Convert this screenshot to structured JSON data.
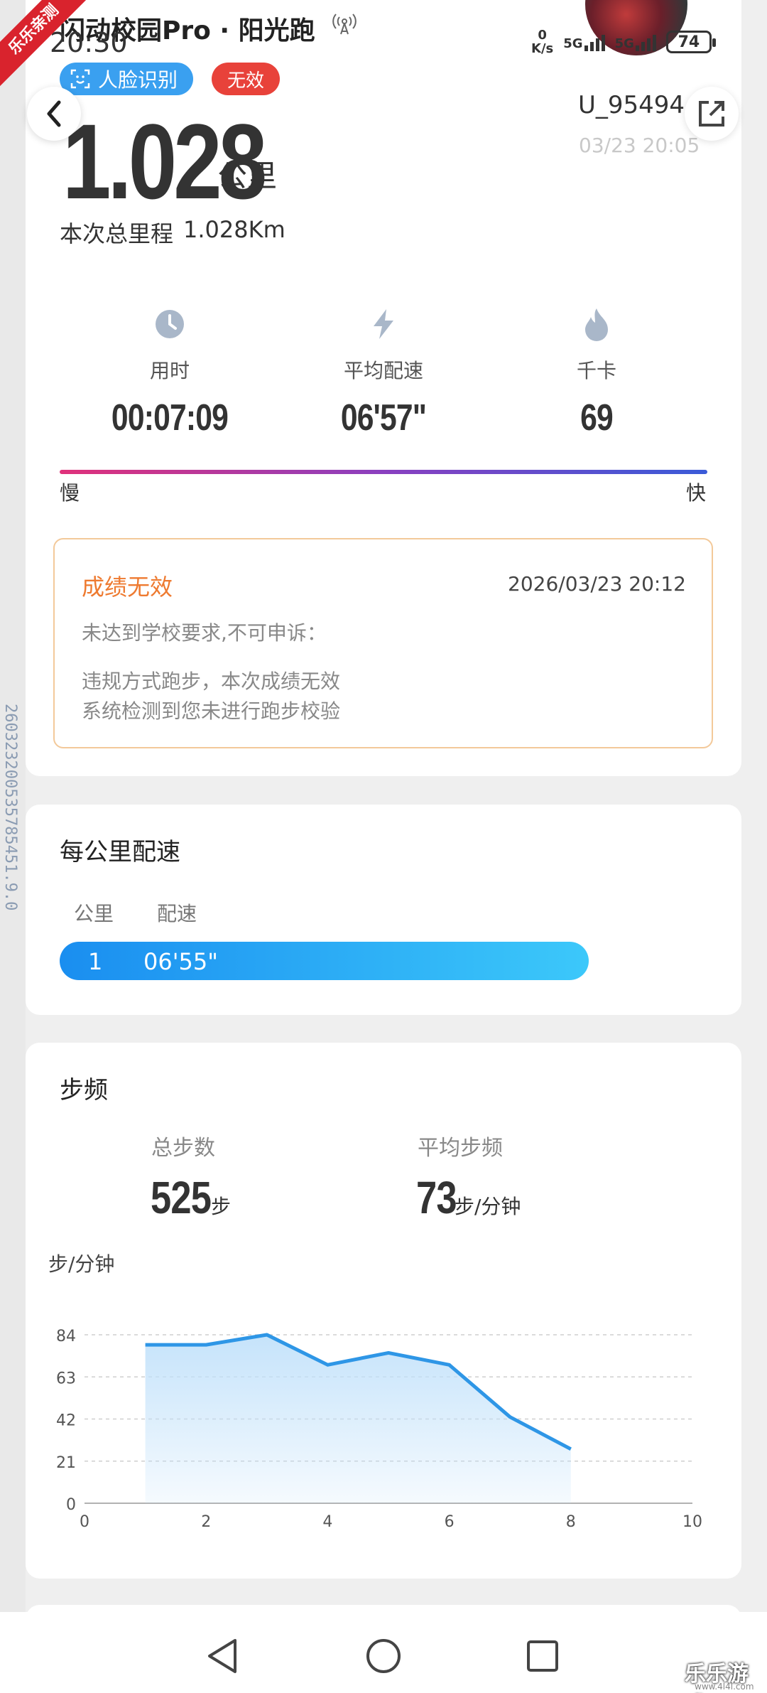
{
  "status_bar": {
    "time": "20:30",
    "net_speed_value": "0",
    "net_speed_unit": "K/s",
    "network_1": "5G",
    "network_2": "5G",
    "battery": "74"
  },
  "corner_badge": "乐乐亲测",
  "header": {
    "title": "闪动校园Pro · 阳光跑",
    "tag_face": "人脸识别",
    "tag_invalid": "无效",
    "user_id": "U_954944",
    "datetime": "03/23 20:05"
  },
  "distance": {
    "value": "1.028",
    "unit": "公里",
    "total_label": "本次总里程",
    "total_value": "1.028Km"
  },
  "metrics": [
    {
      "icon": "clock-icon",
      "label": "用时",
      "value": "00:07:09"
    },
    {
      "icon": "lightning-icon",
      "label": "平均配速",
      "value": "06'57\""
    },
    {
      "icon": "flame-icon",
      "label": "千卡",
      "value": "69"
    }
  ],
  "pace_scale": {
    "slow": "慢",
    "fast": "快",
    "colors": [
      "#e0317a",
      "#8a40c0",
      "#3a5bd8"
    ]
  },
  "invalid_notice": {
    "title": "成绩无效",
    "date": "2026/03/23 20:12",
    "line1": "未达到学校要求,不可申诉：",
    "line2": "违规方式跑步，本次成绩无效",
    "line3": "系统检测到您未进行跑步校验"
  },
  "side_id": "260323200535785451.9.0",
  "per_km": {
    "title": "每公里配速",
    "col_km": "公里",
    "col_pace": "配速",
    "rows": [
      {
        "km": "1",
        "pace": "06'55\""
      }
    ]
  },
  "cadence": {
    "title": "步频",
    "total_steps_label": "总步数",
    "total_steps_value": "525",
    "total_steps_unit": "步",
    "avg_label": "平均步频",
    "avg_value": "73",
    "avg_unit": "步/分钟",
    "axis_unit": "步/分钟"
  },
  "chart_data": {
    "type": "area",
    "xlabel": "",
    "ylabel": "步/分钟",
    "x_ticks": [
      0,
      2,
      4,
      6,
      8,
      10
    ],
    "y_ticks": [
      0,
      21,
      42,
      63,
      84
    ],
    "xlim": [
      0,
      10
    ],
    "ylim": [
      0,
      84
    ],
    "grid": true,
    "series": [
      {
        "x": [
          1,
          2,
          3,
          4,
          5,
          6,
          7,
          8
        ],
        "y": [
          79,
          79,
          84,
          69,
          75,
          69,
          43,
          27
        ]
      }
    ],
    "colors": {
      "line": "#2e96e6",
      "fill_top": "#bfe0fa"
    }
  },
  "watermark": {
    "main": "乐乐游戏",
    "sub": "www.4l4l.com"
  }
}
